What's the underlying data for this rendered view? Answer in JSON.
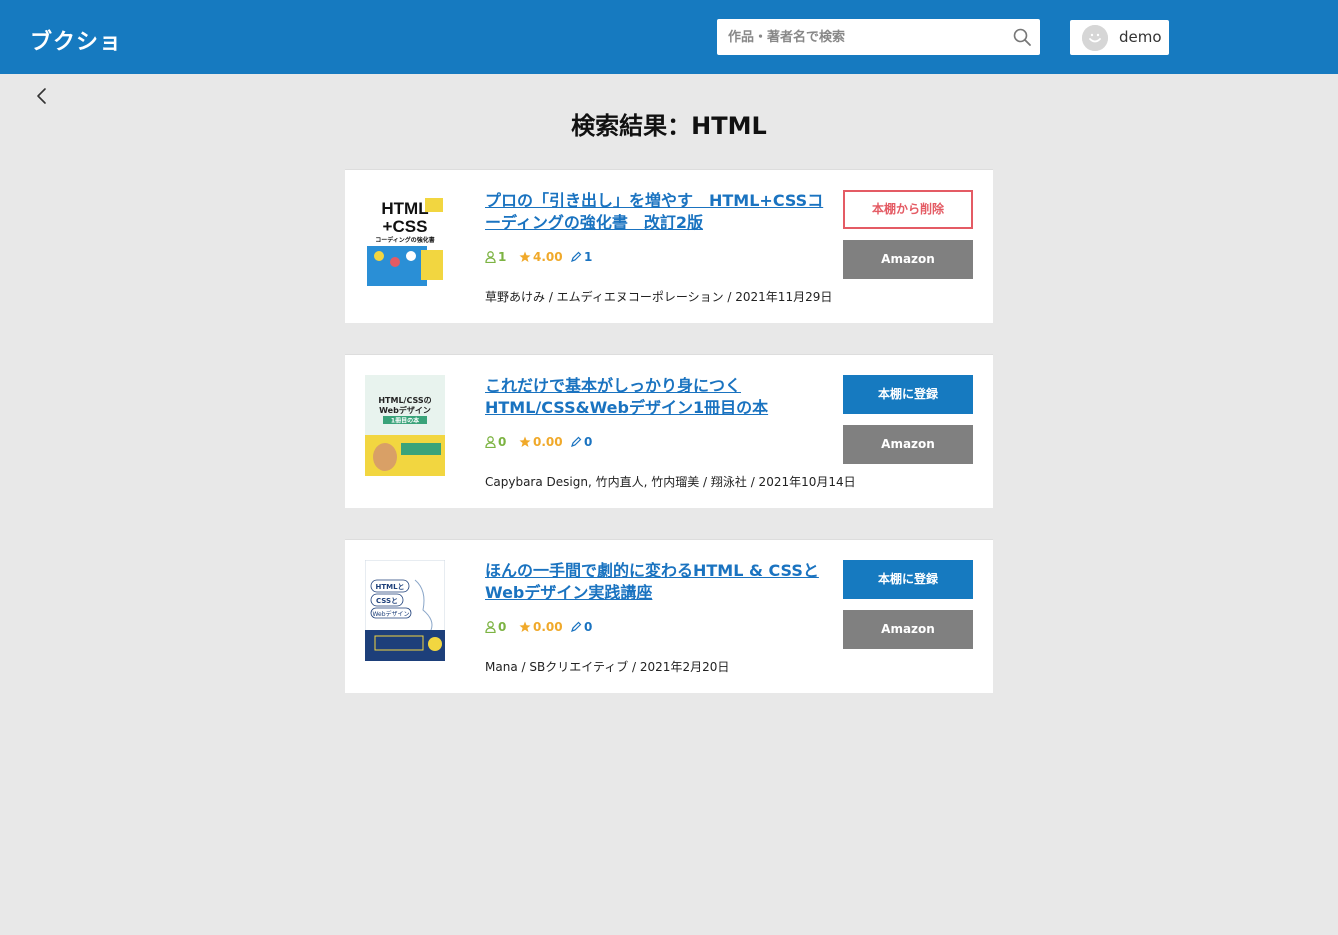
{
  "header": {
    "logo": "ブクショ",
    "search_placeholder": "作品・著者名で検索",
    "user_name": "demo"
  },
  "page_title": "検索結果：HTML",
  "books": [
    {
      "title": "プロの「引き出し」を増やす　HTML+CSSコーディングの強化書　改訂2版",
      "users": "1",
      "rating": "4.00",
      "reviews": "1",
      "meta": "草野あけみ / エムディエヌコーポレーション / 2021年11月29日",
      "action_label": "本棚から削除",
      "action_style": "danger",
      "amazon_label": "Amazon",
      "cover": {
        "bg": "#ffffff",
        "accent": "#2a8fd6",
        "line1": "HTML",
        "line2": "+CSS",
        "line3": "コーディングの強化書"
      }
    },
    {
      "title": "これだけで基本がしっかり身につく HTML/CSS&Webデザイン1冊目の本",
      "users": "0",
      "rating": "0.00",
      "reviews": "0",
      "meta": "Capybara Design, 竹内直人, 竹内瑠美 / 翔泳社 / 2021年10月14日",
      "action_label": "本棚に登録",
      "action_style": "primary",
      "amazon_label": "Amazon",
      "cover": {
        "bg": "#e8f3ee",
        "accent": "#f2d640",
        "line1": "HTML/CSSの",
        "line2": "Webデザイン",
        "line3": "1冊目の本"
      }
    },
    {
      "title": "ほんの一手間で劇的に変わるHTML & CSSとWebデザイン実践講座",
      "users": "0",
      "rating": "0.00",
      "reviews": "0",
      "meta": "Mana / SBクリエイティブ / 2021年2月20日",
      "action_label": "本棚に登録",
      "action_style": "primary",
      "amazon_label": "Amazon",
      "cover": {
        "bg": "#ffffff",
        "accent": "#1d3f7a",
        "line1": "HTMLと",
        "line2": "CSSと",
        "line3": "Webデザイン"
      }
    }
  ]
}
